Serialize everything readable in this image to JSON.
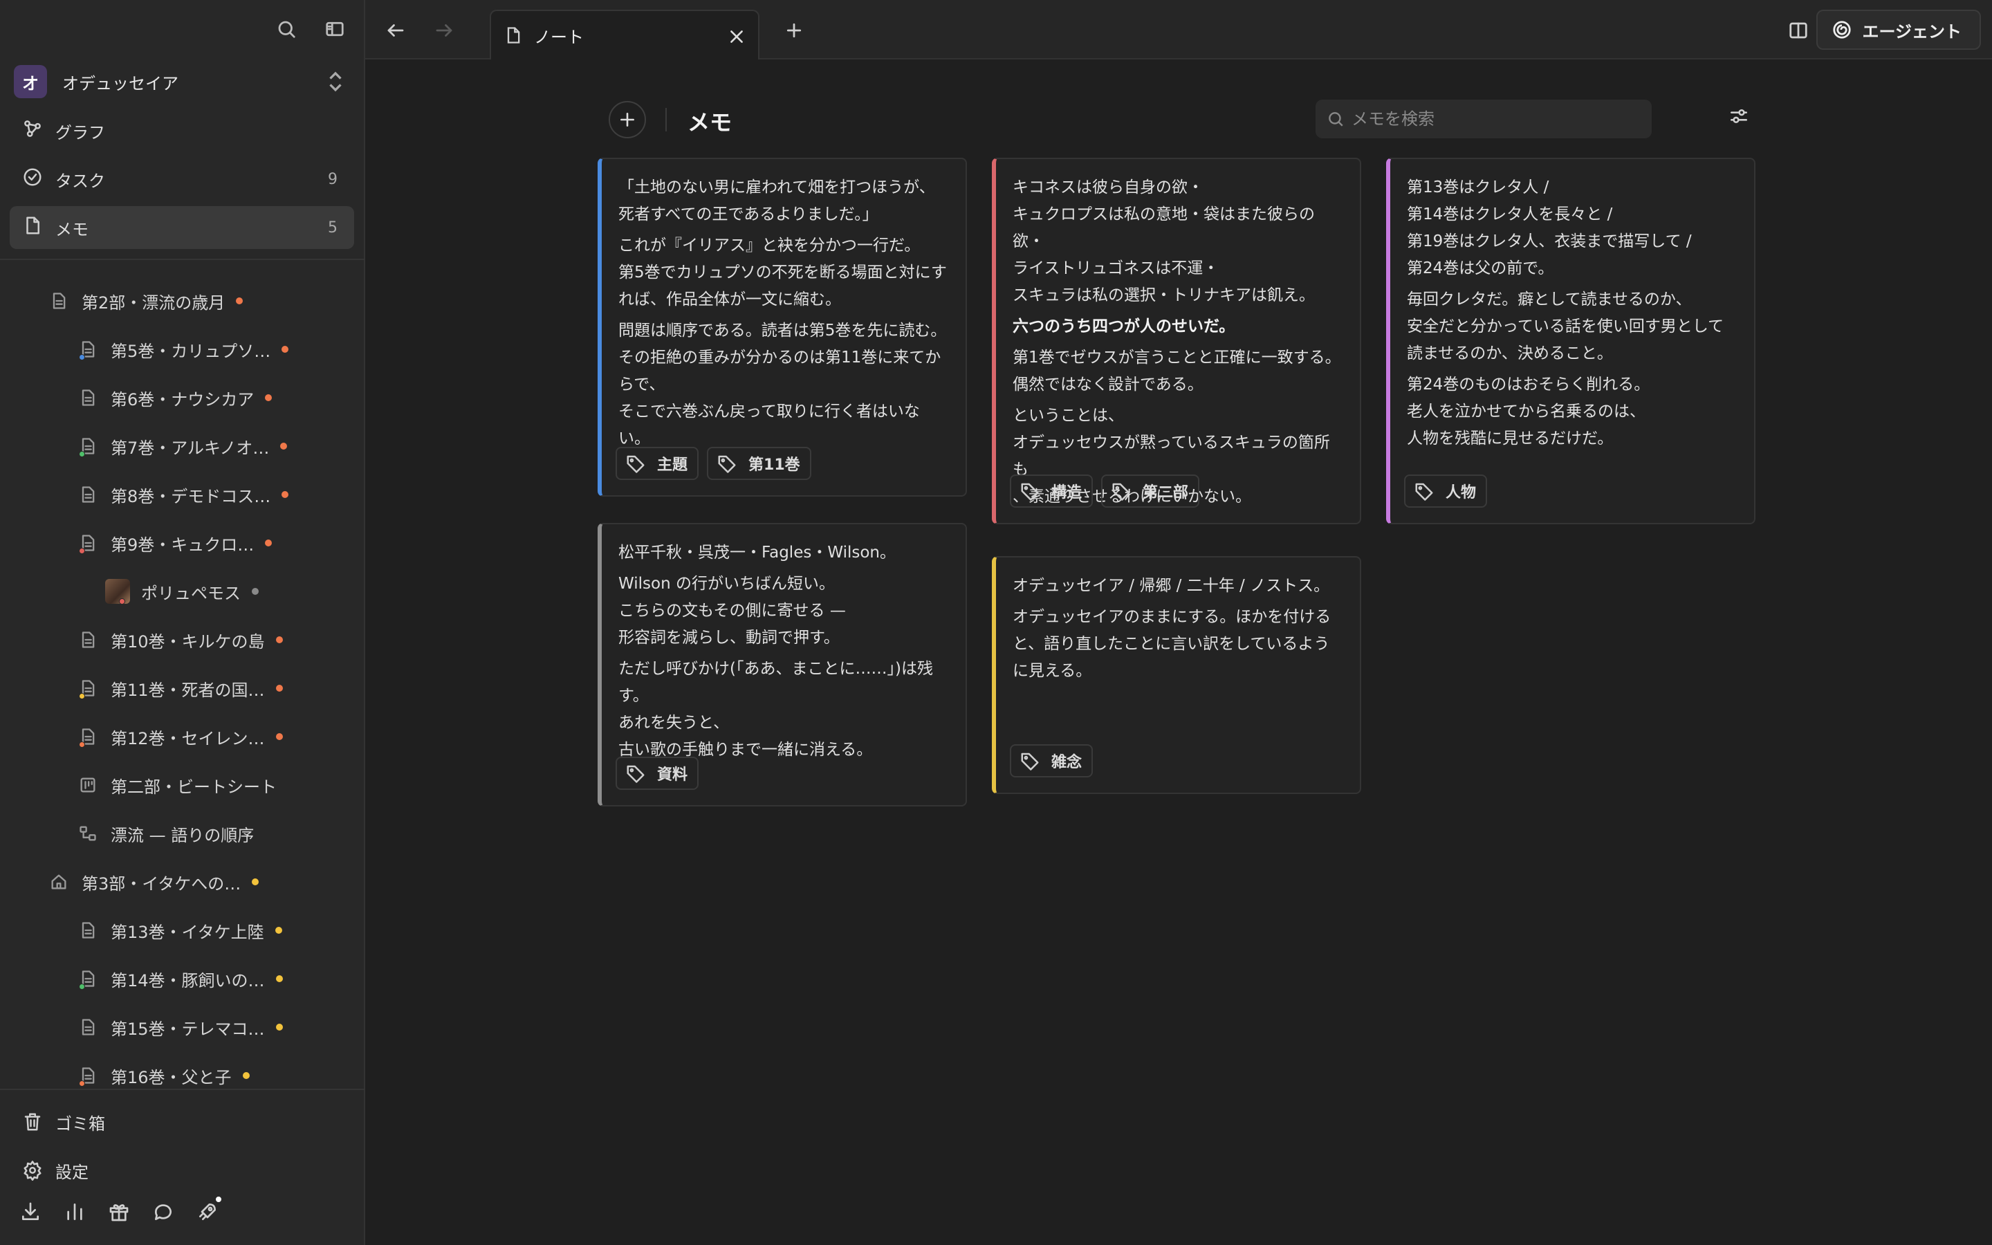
{
  "sidebar": {
    "workspace": {
      "initial": "オ",
      "name": "オデュッセイア"
    },
    "nav": [
      {
        "label": "グラフ",
        "count": ""
      },
      {
        "label": "タスク",
        "count": "9"
      },
      {
        "label": "メモ",
        "count": "5"
      }
    ],
    "tree": [
      {
        "label": "第2部・漂流の歳月",
        "dot": "#f0784a"
      },
      {
        "label": "第5巻・カリュプソ…",
        "dot": "#f0784a"
      },
      {
        "label": "第6巻・ナウシカア",
        "dot": "#f0784a"
      },
      {
        "label": "第7巻・アルキノオ…",
        "dot": "#f0784a"
      },
      {
        "label": "第8巻・デモドコス…",
        "dot": "#f0784a"
      },
      {
        "label": "第9巻・キュクロ…",
        "dot": "#f0784a"
      },
      {
        "label": "ポリュペモス",
        "dot": "#8a8a8a"
      },
      {
        "label": "第10巻・キルケの島",
        "dot": "#f0784a"
      },
      {
        "label": "第11巻・死者の国…",
        "dot": "#f0784a"
      },
      {
        "label": "第12巻・セイレン…",
        "dot": "#f0784a"
      },
      {
        "label": "第二部・ビートシート",
        "dot": ""
      },
      {
        "label": "漂流 — 語りの順序",
        "dot": ""
      },
      {
        "label": "第3部・イタケへの…",
        "dot": "#f3c33c"
      },
      {
        "label": "第13巻・イタケ上陸",
        "dot": "#f3c33c"
      },
      {
        "label": "第14巻・豚飼いの…",
        "dot": "#f3c33c"
      },
      {
        "label": "第15巻・テレマコ…",
        "dot": "#f3c33c"
      },
      {
        "label": "第16巻・父と子",
        "dot": "#f3c33c"
      }
    ],
    "bottom": {
      "trash": "ゴミ箱",
      "settings": "設定"
    }
  },
  "topbar": {
    "tab_label": "ノート",
    "agent_label": "エージェント"
  },
  "main": {
    "title": "メモ",
    "search_placeholder": "メモを検索",
    "cards": [
      {
        "accent": "#4a8be0",
        "paragraphs": [
          "「土地のない男に雇われて畑を打つほうが、\n死者すべての王であるよりましだ。」",
          "これが『イリアス』と袂を分かつ一行だ。\n第5巻でカリュプソの不死を断る場面と対にすれば、作品全体が一文に縮む。",
          "問題は順序である。読者は第5巻を先に読む。\nその拒絶の重みが分かるのは第11巻に来てからで、\nそこで六巻ぶん戻って取りに行く者はいない。"
        ],
        "tags": [
          "主題",
          "第11巻"
        ]
      },
      {
        "accent": "#d9676b",
        "paragraphs": [
          "キコネスは彼ら自身の欲・\nキュクロプスは私の意地・袋はまた彼らの欲・\nライストリュゴネスは不運・\nスキュラは私の選択・トリナキアは飢え。",
          "六つのうち四つが人のせいだ。",
          "第1巻でゼウスが言うことと正確に一致する。\n偶然ではなく設計である。",
          "ということは、\nオデュッセウスが黙っているスキュラの箇所も\n、素通りさせるわけにいかない。"
        ],
        "tags": [
          "構造",
          "第二部"
        ]
      },
      {
        "accent": "#c77be0",
        "paragraphs": [
          "第13巻はクレタ人 /\n第14巻はクレタ人を長々と /\n第19巻はクレタ人、衣装まで描写して /\n第24巻は父の前で。",
          "毎回クレタだ。癖として読ませるのか、\n安全だと分かっている話を使い回す男として読ませるのか、決めること。",
          "第24巻のものはおそらく削れる。\n老人を泣かせてから名乗るのは、\n人物を残酷に見せるだけだ。"
        ],
        "tags": [
          "人物"
        ]
      },
      {
        "accent": "#8e8e8e",
        "paragraphs": [
          "松平千秋・呉茂一・Fagles・Wilson。",
          "Wilson の行がいちばん短い。\nこちらの文もその側に寄せる —\n形容詞を減らし、動詞で押す。",
          "ただし呼びかけ(「ああ、まことに……」)は残す。\nあれを失うと、\n古い歌の手触りまで一緒に消える。"
        ],
        "tags": [
          "資料"
        ]
      },
      {
        "accent": "#e6c243",
        "paragraphs": [
          "オデュッセイア / 帰郷 / 二十年 / ノストス。",
          "オデュッセイアのままにする。ほかを付けると、語り直したことに言い訳をしているように見える。"
        ],
        "tags": [
          "雑念"
        ]
      }
    ]
  }
}
